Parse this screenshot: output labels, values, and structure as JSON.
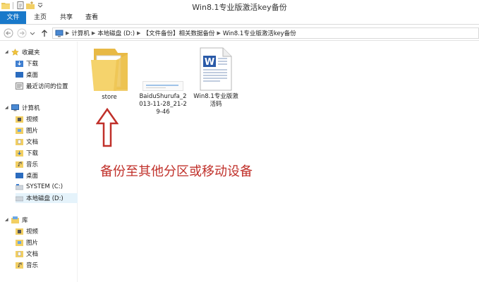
{
  "window": {
    "title": "Win8.1专业版激活key备份"
  },
  "ribbon": {
    "tabs": [
      "文件",
      "主页",
      "共享",
      "查看"
    ],
    "help": "?"
  },
  "address": {
    "crumbs": [
      "计算机",
      "本地磁盘 (D:)",
      "【文件备份】相关数据备份",
      "Win8.1专业版激活key备份"
    ]
  },
  "sidebar": {
    "favorites": {
      "label": "收藏夹",
      "items": [
        "下载",
        "桌面",
        "最近访问的位置"
      ]
    },
    "computer": {
      "label": "计算机",
      "items": [
        "视频",
        "图片",
        "文档",
        "下载",
        "音乐",
        "桌面",
        "SYSTEM (C:)",
        "本地磁盘 (D:)"
      ]
    },
    "library": {
      "label": "库",
      "items": [
        "视频",
        "图片",
        "文档",
        "音乐"
      ]
    }
  },
  "files": [
    {
      "name": "store",
      "icon": "folder-icon"
    },
    {
      "name": "BaiduShurufa_2013-11-28_21-29-46",
      "line1": "BaiduShurufa_2",
      "line2": "013-11-28_21-2",
      "line3": "9-46",
      "icon": "image-thumbnail-icon"
    },
    {
      "name": "Win8.1专业版激活码",
      "line1": "Win8.1专业版激",
      "line2": "活码",
      "icon": "word-document-icon"
    }
  ],
  "annotation": {
    "text": "备份至其他分区或移动设备",
    "color": "#c0302a"
  },
  "colors": {
    "accent": "#1979ca",
    "selection": "#e5f3fb"
  }
}
